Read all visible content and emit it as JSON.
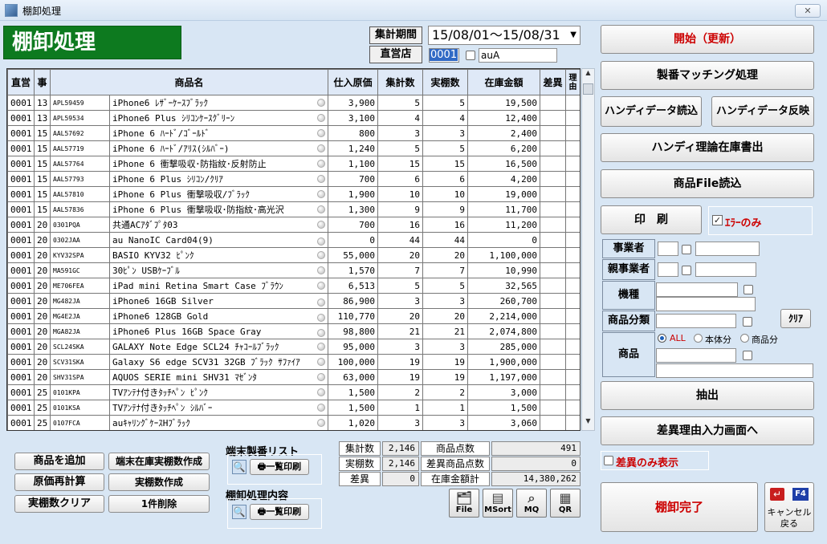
{
  "window": {
    "title": "棚卸処理",
    "close": "✕"
  },
  "header": {
    "app_title": "棚卸処理",
    "period_label": "集計期間",
    "period_value": "15/08/01～15/08/31",
    "store_label": "直営店",
    "store_code": "0001",
    "store_name": "auA"
  },
  "grid": {
    "columns": [
      "直営",
      "事",
      "商品名",
      "仕入原価",
      "集計数",
      "実棚数",
      "在庫金額",
      "差異",
      "理由"
    ],
    "rows": [
      [
        "0001",
        "13",
        "APL59459",
        "iPhone6 ﾚｻﾞｰｹｰｽﾌﾞﾗｯｸ",
        "3,900",
        "5",
        "5",
        "19,500"
      ],
      [
        "0001",
        "13",
        "APL59534",
        "iPhone6 Plus ｼﾘｺﾝｹｰｽｸﾞﾘｰﾝ",
        "3,100",
        "4",
        "4",
        "12,400"
      ],
      [
        "0001",
        "15",
        "AAL57692",
        "iPhone 6 ﾊｰﾄﾞ/ｺﾞｰﾙﾄﾞ",
        "800",
        "3",
        "3",
        "2,400"
      ],
      [
        "0001",
        "15",
        "AAL57719",
        "iPhone 6 ﾊｰﾄﾞ/ｱﾘｽ(ｼﾙﾊﾞｰ)",
        "1,240",
        "5",
        "5",
        "6,200"
      ],
      [
        "0001",
        "15",
        "AAL57764",
        "iPhone 6 衝撃吸収･防指紋･反射防止",
        "1,100",
        "15",
        "15",
        "16,500"
      ],
      [
        "0001",
        "15",
        "AAL57793",
        "iPhone 6 Plus ｼﾘｺﾝ/ｸﾘｱ",
        "700",
        "6",
        "6",
        "4,200"
      ],
      [
        "0001",
        "15",
        "AAL57810",
        "iPhone 6 Plus 衝撃吸収/ﾌﾞﾗｯｸ",
        "1,900",
        "10",
        "10",
        "19,000"
      ],
      [
        "0001",
        "15",
        "AAL57836",
        "iPhone 6 Plus 衝撃吸収･防指紋･高光沢",
        "1,300",
        "9",
        "9",
        "11,700"
      ],
      [
        "0001",
        "20",
        "0301PQA",
        "共通ACｱﾀﾞﾌﾟﾀ03",
        "700",
        "16",
        "16",
        "11,200"
      ],
      [
        "0001",
        "20",
        "0302JAA",
        "au NanoIC Card04(9)",
        "0",
        "44",
        "44",
        "0"
      ],
      [
        "0001",
        "20",
        "KYV32SPA",
        "BASIO KYV32 ﾋﾟﾝｸ",
        "55,000",
        "20",
        "20",
        "1,100,000"
      ],
      [
        "0001",
        "20",
        "MA591GC",
        "30ﾋﾟﾝ USBｹｰﾌﾞﾙ",
        "1,570",
        "7",
        "7",
        "10,990"
      ],
      [
        "0001",
        "20",
        "ME706FEA",
        "iPad mini Retina Smart Case ﾌﾞﾗｳﾝ",
        "6,513",
        "5",
        "5",
        "32,565"
      ],
      [
        "0001",
        "20",
        "MG482JA",
        "iPhone6 16GB Silver",
        "86,900",
        "3",
        "3",
        "260,700"
      ],
      [
        "0001",
        "20",
        "MG4E2JA",
        "iPhone6 128GB Gold",
        "110,770",
        "20",
        "20",
        "2,214,000"
      ],
      [
        "0001",
        "20",
        "MGA82JA",
        "iPhone6 Plus 16GB Space Gray",
        "98,800",
        "21",
        "21",
        "2,074,800"
      ],
      [
        "0001",
        "20",
        "SCL24SKA",
        "GALAXY Note Edge SCL24 ﾁｬｺｰﾙﾌﾞﾗｯｸ",
        "95,000",
        "3",
        "3",
        "285,000"
      ],
      [
        "0001",
        "20",
        "SCV31SKA",
        "Galaxy S6 edge SCV31 32GB ﾌﾞﾗｯｸ ｻﾌｧｲｱ",
        "100,000",
        "19",
        "19",
        "1,900,000"
      ],
      [
        "0001",
        "20",
        "SHV31SPA",
        "AQUOS SERIE mini SHV31 ﾏｾﾞﾝﾀ",
        "63,000",
        "19",
        "19",
        "1,197,000"
      ],
      [
        "0001",
        "25",
        "0101KPA",
        "TVｱﾝﾃﾅ付きﾀｯﾁﾍﾟﾝ ﾋﾟﾝｸ",
        "1,500",
        "2",
        "2",
        "3,000"
      ],
      [
        "0001",
        "25",
        "0101KSA",
        "TVｱﾝﾃﾅ付きﾀｯﾁﾍﾟﾝ ｼﾙﾊﾞｰ",
        "1,500",
        "1",
        "1",
        "1,500"
      ],
      [
        "0001",
        "25",
        "0107FCA",
        "auｷｬﾘﾝｸﾞｹｰｽHﾌﾞﾗｯｸ",
        "1,020",
        "3",
        "3",
        "3,060"
      ]
    ]
  },
  "left_buttons": {
    "add_product": "商品を追加",
    "terminal_stock": "端末在庫実棚数作成",
    "recalc_cost": "原価再計算",
    "create_count": "実棚数作成",
    "clear_count": "実棚数クリア",
    "delete_one": "1件削除"
  },
  "serial_list": {
    "label": "端末製番リスト",
    "print": "一覧印刷"
  },
  "inventory_content": {
    "label": "棚卸処理内容",
    "print": "一覧印刷"
  },
  "summary": {
    "total_label": "集計数",
    "total_value": "2,146",
    "actual_label": "実棚数",
    "actual_value": "2,146",
    "diff_label": "差異",
    "diff_value": "0",
    "items_label": "商品点数",
    "items_value": "491",
    "diff_items_label": "差異商品点数",
    "diff_items_value": "0",
    "amount_label": "在庫金額計",
    "amount_value": "14,380,262"
  },
  "icon_buttons": {
    "file": "File",
    "msort": "MSort",
    "mq": "MQ",
    "qr": "QR"
  },
  "right_panel": {
    "start": "開始（更新）",
    "matching": "製番マッチング処理",
    "handy_read": "ハンディデータ読込",
    "handy_reflect": "ハンディデータ反映",
    "handy_export": "ハンディ理論在庫書出",
    "product_file": "商品File読込",
    "print": "印　刷",
    "error_only": "ｴﾗｰのみ",
    "filters": {
      "operator": "事業者",
      "parent_operator": "親事業者",
      "model": "機種",
      "category": "商品分類",
      "product": "商品"
    },
    "clear": "ｸﾘｱ",
    "radio_all": "ALL",
    "radio_main": "本体分",
    "radio_product": "商品分",
    "extract": "抽出",
    "diff_reason": "差異理由入力画面へ",
    "diff_only": "差異のみ表示",
    "complete": "棚卸完了",
    "cancel_key": "F4",
    "cancel": "キャンセル",
    "back": "戻る"
  },
  "colors": {
    "title_green": "#0d7a1f",
    "accent_red": "#cc0000",
    "bg": "#d8e6f4"
  }
}
